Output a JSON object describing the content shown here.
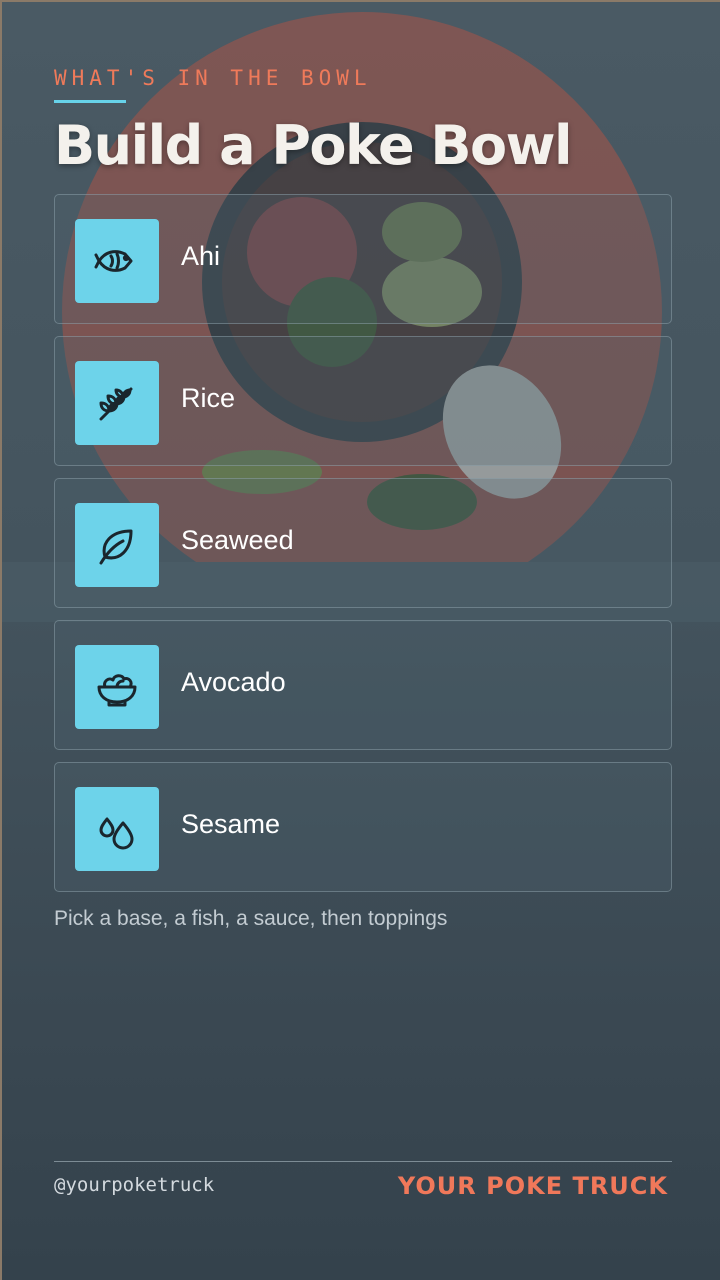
{
  "header": {
    "kicker": "WHAT'S IN THE BOWL",
    "title": "Build a Poke Bowl"
  },
  "ingredients": [
    {
      "label": "Ahi",
      "icon": "fish-icon"
    },
    {
      "label": "Rice",
      "icon": "wheat-icon"
    },
    {
      "label": "Seaweed",
      "icon": "leaf-icon"
    },
    {
      "label": "Avocado",
      "icon": "salad-bowl-icon"
    },
    {
      "label": "Sesame",
      "icon": "droplets-icon"
    }
  ],
  "hint": "Pick a base, a fish, a sauce, then toppings",
  "footer": {
    "handle": "@yourpoketruck",
    "brand": "YOUR POKE TRUCK"
  },
  "colors": {
    "accent": "#ef7a5a",
    "icon_tile": "#6dd3ea",
    "background": "#44545e"
  }
}
